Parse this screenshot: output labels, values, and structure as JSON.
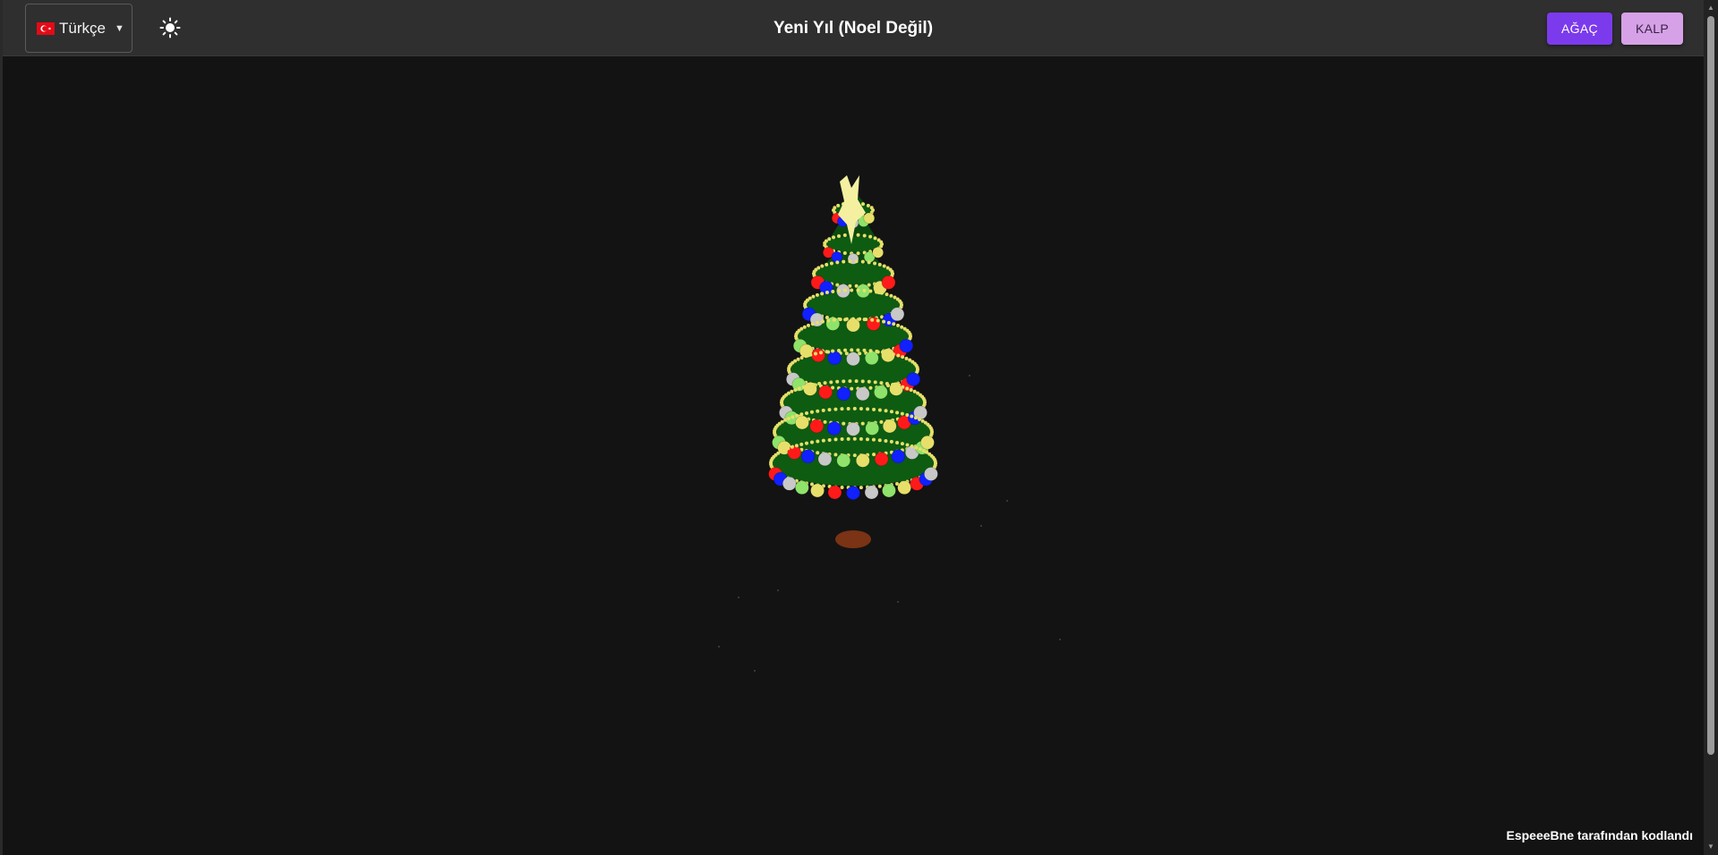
{
  "header": {
    "language": {
      "label": "Türkçe",
      "flag_icon": "turkey-flag-icon",
      "caret_icon": "caret-down-icon"
    },
    "theme_toggle_icon": "sun-icon",
    "title": "Yeni Yıl (Noel Değil)",
    "buttons": {
      "tree_label": "AĞAÇ",
      "heart_label": "KALP"
    }
  },
  "colors": {
    "topbar": "#2f2f2f",
    "background": "#131313",
    "primary_button": "#7c3aed",
    "secondary_button": "#d6a1e6",
    "tree_green": "#0d5c12",
    "star": "#f4f0a0",
    "trunk": "#7a3314",
    "ornament_colors": [
      "#ff1a1a",
      "#1020ff",
      "#c8c8c8",
      "#8fe36a",
      "#e6e06a"
    ]
  },
  "scene": {
    "object": "tree-3d",
    "star_icon": "star-icon"
  },
  "footer": {
    "credit": "EspeeeBne tarafından kodlandı"
  }
}
